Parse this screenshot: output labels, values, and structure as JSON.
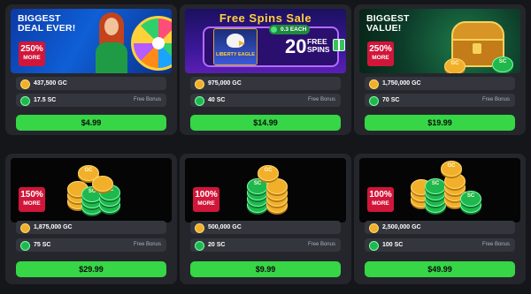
{
  "packages": [
    {
      "headline": "Biggest Deal Ever!",
      "badge_pct": "250%",
      "badge_more": "MORE",
      "gc": "437,500 GC",
      "sc": "17.5 SC",
      "bonus": "Free Bonus",
      "price": "$4.99"
    },
    {
      "headline": "Free Spins Sale",
      "each": "0.3 EACH",
      "spins_count": "20",
      "spins_label": "FREE SPINS",
      "game_logo": "LIBERTY EAGLE",
      "gc": "975,000 GC",
      "sc": "40 SC",
      "bonus": "Free Bonus",
      "price": "$14.99"
    },
    {
      "headline": "Biggest Value!",
      "badge_pct": "250%",
      "badge_more": "MORE",
      "gc": "1,750,000 GC",
      "sc": "70 SC",
      "bonus": "Free Bonus",
      "price": "$19.99"
    },
    {
      "badge_pct": "150%",
      "badge_more": "MORE",
      "gc": "1,875,000 GC",
      "sc": "75 SC",
      "bonus": "Free Bonus",
      "price": "$29.99"
    },
    {
      "badge_pct": "100%",
      "badge_more": "MORE",
      "gc": "500,000 GC",
      "sc": "20 SC",
      "bonus": "Free Bonus",
      "price": "$9.99"
    },
    {
      "badge_pct": "100%",
      "badge_more": "MORE",
      "gc": "2,500,000 GC",
      "sc": "100 SC",
      "bonus": "Free Bonus",
      "price": "$49.99"
    }
  ],
  "coin_text": {
    "gold": "GC",
    "sweeps": "SC"
  },
  "icons": {
    "gc": "gold-coin-icon",
    "sc": "sweeps-coin-icon",
    "gift": "gift-icon"
  },
  "colors": {
    "buy_button": "#36d646",
    "badge": "#d1163a",
    "card": "#25262c",
    "page": "#15161a"
  }
}
